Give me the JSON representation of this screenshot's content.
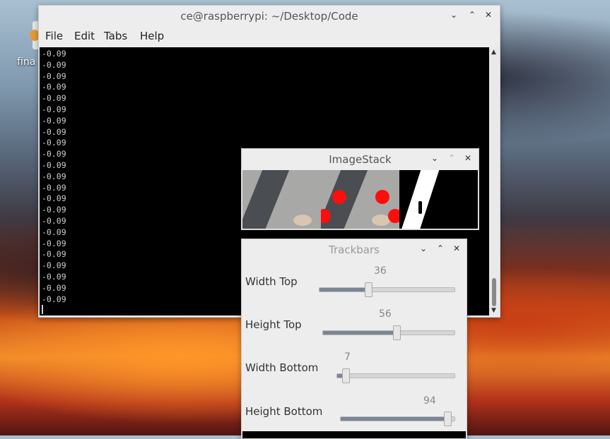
{
  "desktop": {
    "icon_label": "fina"
  },
  "terminal": {
    "title": "ce@raspberrypi: ~/Desktop/Code",
    "menu": [
      "File",
      "Edit",
      "Tabs",
      "Help"
    ],
    "lines": [
      "-0.09",
      "-0.09",
      "-0.09",
      "-0.09",
      "-0.09",
      "-0.09",
      "-0.09",
      "-0.09",
      "-0.09",
      "-0.09",
      "-0.09",
      "-0.09",
      "-0.09",
      "-0.09",
      "-0.09",
      "-0.09",
      "-0.09",
      "-0.09",
      "-0.09",
      "-0.09",
      "-0.09",
      "-0.09",
      "-0.09"
    ]
  },
  "imagestack": {
    "title": "ImageStack"
  },
  "trackbars": {
    "title": "Trackbars",
    "sliders": [
      {
        "label": "Width Top",
        "value": "36"
      },
      {
        "label": "Height Top",
        "value": "56"
      },
      {
        "label": "Width Bottom",
        "value": "7"
      },
      {
        "label": "Height Bottom",
        "value": "94"
      }
    ]
  }
}
